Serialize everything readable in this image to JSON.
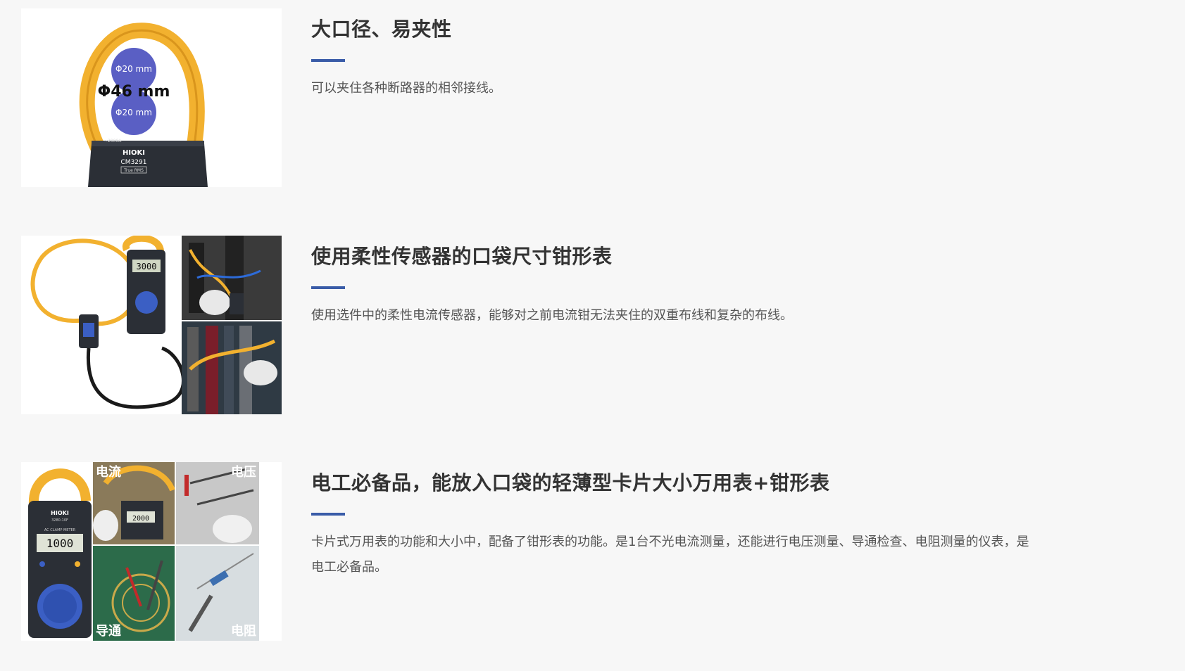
{
  "features": [
    {
      "title": "大口径、易夹性",
      "description": "可以夹住各种断路器的相邻接线。",
      "image": {
        "labels": {
          "top_circle": "Φ20 mm",
          "big_label": "Φ46 mm",
          "bottom_circle": "Φ20 mm",
          "brand": "HIOKI",
          "model": "CM3291",
          "badge": "True RMS",
          "range": "~2000A"
        }
      }
    },
    {
      "title": "使用柔性传感器的口袋尺寸钳形表",
      "description": "使用选件中的柔性电流传感器，能够对之前电流钳无法夹住的双重布线和复杂的布线。",
      "image": {
        "labels": {
          "display": "3000"
        }
      }
    },
    {
      "title": "电工必备品，能放入口袋的轻薄型卡片大小万用表+钳形表",
      "description": "卡片式万用表的功能和大小中，配备了钳形表的功能。是1台不光电流测量，还能进行电压测量、导通检查、电阻测量的仪表，是电工必备品。",
      "image": {
        "labels": {
          "brand": "HIOKI",
          "model": "3280-10F",
          "meter_caption": "AC CLAMP METER",
          "display": "1000",
          "small_display": "2000",
          "quad_current": "电流",
          "quad_voltage": "电压",
          "quad_continuity": "导通",
          "quad_resistance": "电阻"
        }
      }
    }
  ],
  "colors": {
    "background": "#f7f7f7",
    "accent": "#3a5ca8",
    "title": "#333333",
    "body_text": "#555555",
    "clamp_yellow": "#f2b12f",
    "meter_dark": "#2b2f36",
    "dial_blue": "#3b5fc4"
  }
}
